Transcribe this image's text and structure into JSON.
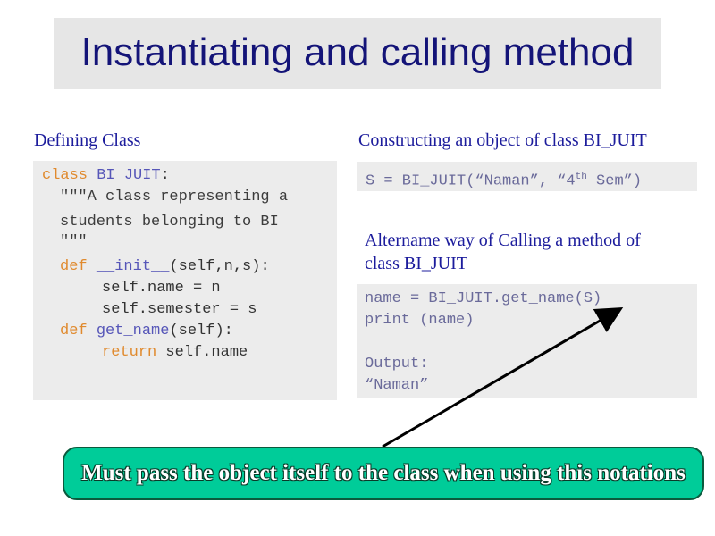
{
  "title": "Instantiating and calling method",
  "left": {
    "heading": "Defining  Class",
    "code": {
      "l1_kw": "class",
      "l1_name": "BI_JUIT",
      "l1_rest": ":",
      "l2": "\"\"\"A class representing a",
      "l3": "students belonging to BI",
      "l4": "\"\"\"",
      "l5_kw": "def",
      "l5_name": "__init__",
      "l5_rest": "(self,n,s):",
      "l6": "self.name = n",
      "l7": "self.semester = s",
      "l8_kw": "def",
      "l8_name": "get_name",
      "l8_rest": "(self):",
      "l9_kw": "return",
      "l9_rest": " self.name"
    }
  },
  "right": {
    "heading1": "Constructing an object of class BI_JUIT",
    "code1": {
      "pre": "S = BI_JUIT(“Naman”, “4",
      "sup": "th",
      "post": " Sem”)"
    },
    "heading2_line1": "Altername way of Calling a method of",
    "heading2_line2": "class BI_JUIT",
    "code2": {
      "l1": "name = BI_JUIT.get_name(S)",
      "l2": "print (name)",
      "l3": "Output:",
      "l4": "“Naman”"
    }
  },
  "callout": "Must pass the object itself to the class when using this notations",
  "colors": {
    "title": "#141478",
    "heading": "#1c1c9c",
    "code_bg": "#ececec",
    "keyword": "#e08a2e",
    "name": "#5656b8",
    "callout_bg": "#00cc99"
  }
}
